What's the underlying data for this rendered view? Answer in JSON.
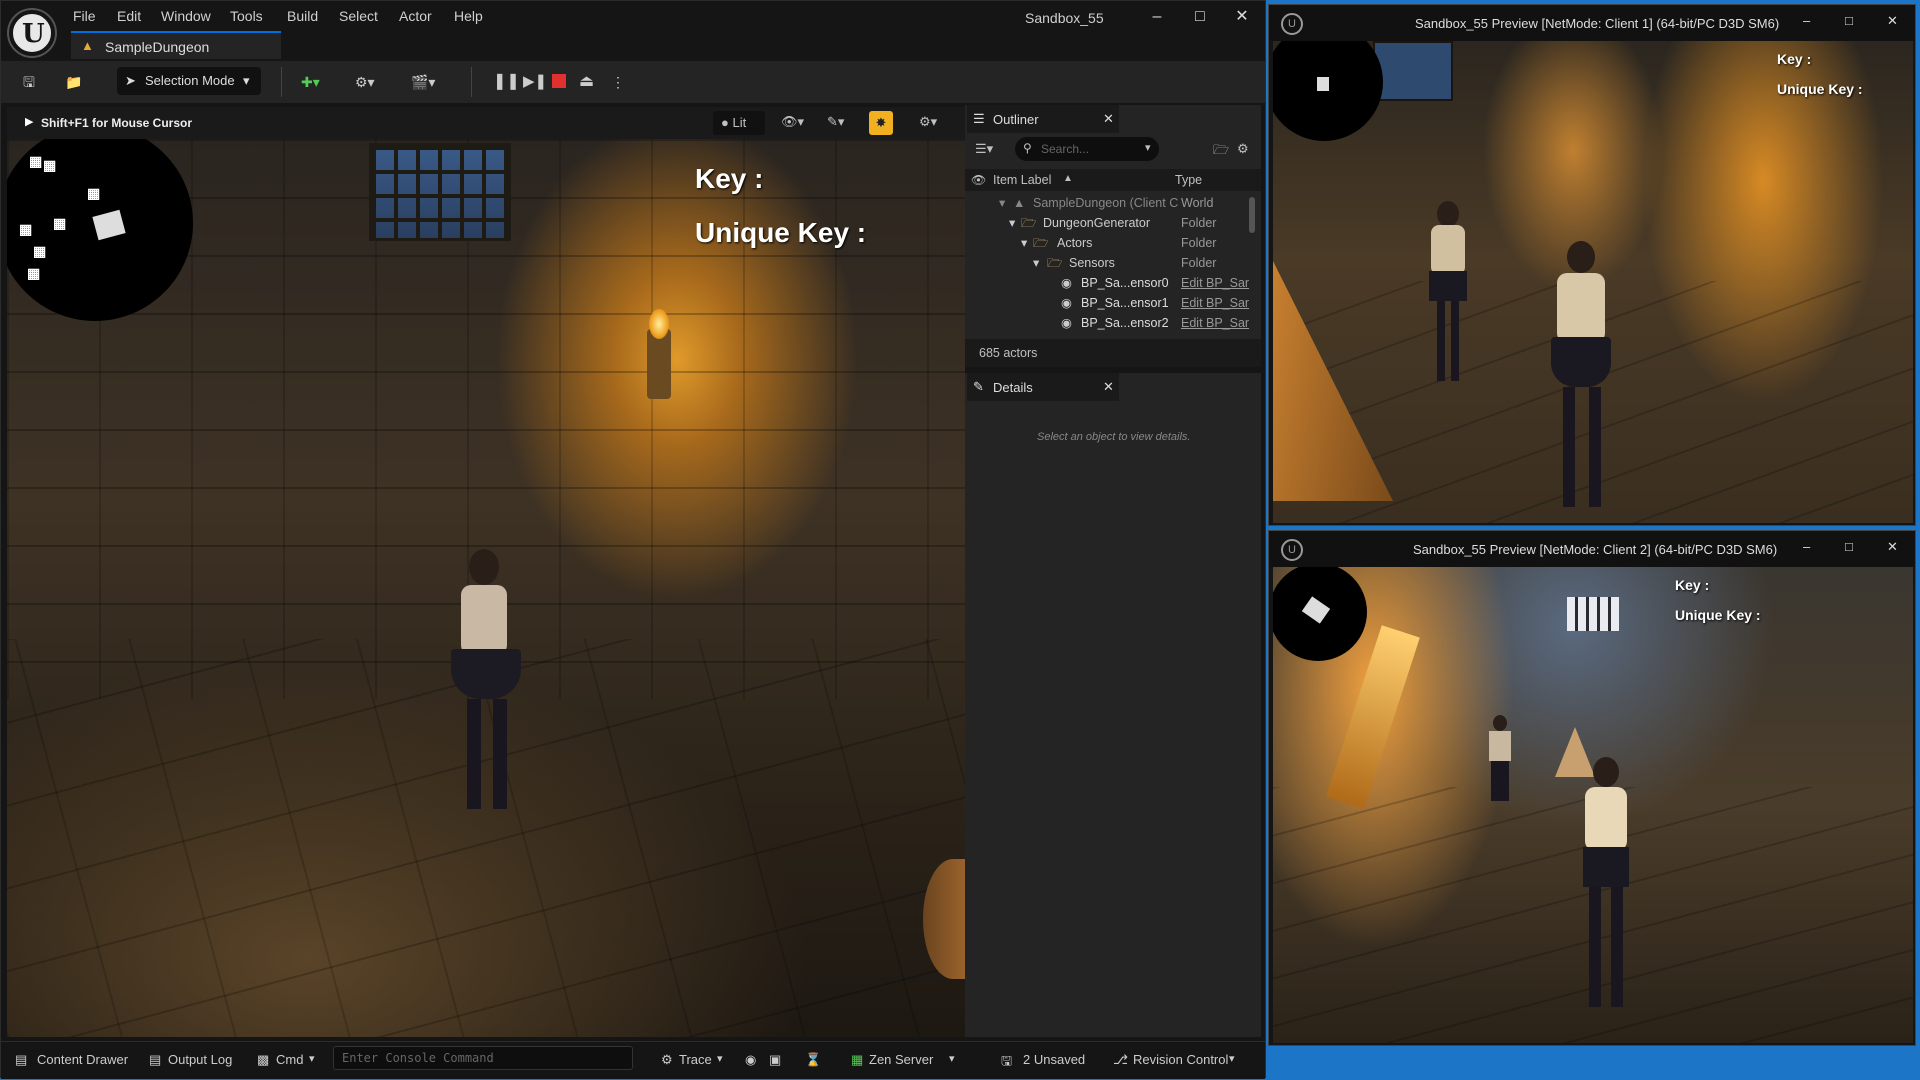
{
  "app": {
    "logo_letter": "U",
    "menu": [
      "File",
      "Edit",
      "Window",
      "Tools",
      "Build",
      "Select",
      "Actor",
      "Help"
    ],
    "window_title": "Sandbox_55",
    "doc_tab": "SampleDungeon"
  },
  "toolbar": {
    "mode_label": "Selection Mode"
  },
  "viewport": {
    "hint": "Shift+F1 for Mouse Cursor",
    "view_mode": "Lit",
    "hud_key": "Key :",
    "hud_unique_key": "Unique Key :"
  },
  "outliner": {
    "tab": "Outliner",
    "search_placeholder": "Search...",
    "col_label": "Item Label",
    "col_type": "Type",
    "rows": [
      {
        "label": "SampleDungeon (Client C",
        "type": "World"
      },
      {
        "label": "DungeonGenerator",
        "type": "Folder"
      },
      {
        "label": "Actors",
        "type": "Folder"
      },
      {
        "label": "Sensors",
        "type": "Folder"
      },
      {
        "label": "BP_Sa...ensor0",
        "type": "Edit BP_Sar"
      },
      {
        "label": "BP_Sa...ensor1",
        "type": "Edit BP_Sar"
      },
      {
        "label": "BP_Sa...ensor2",
        "type": "Edit BP_Sar"
      }
    ],
    "count": "685 actors"
  },
  "details": {
    "tab": "Details",
    "empty": "Select an object to view details."
  },
  "statusbar": {
    "content_drawer": "Content Drawer",
    "output_log": "Output Log",
    "cmd": "Cmd",
    "console_placeholder": "Enter Console Command",
    "trace": "Trace",
    "zen": "Zen Server",
    "unsaved": "2 Unsaved",
    "revision": "Revision Control"
  },
  "preview1": {
    "title": "Sandbox_55 Preview [NetMode: Client 1]  (64-bit/PC D3D SM6)",
    "hud_key": "Key :",
    "hud_unique_key": "Unique Key :"
  },
  "preview2": {
    "title": "Sandbox_55 Preview [NetMode: Client 2]  (64-bit/PC D3D SM6)",
    "hud_key": "Key :",
    "hud_unique_key": "Unique Key :"
  },
  "colors": {
    "accent": "#0070e0",
    "play_stop": "#e03030",
    "highlight": "#f0b020",
    "link": "#4a9eff",
    "desktop": "#1d75c8"
  }
}
